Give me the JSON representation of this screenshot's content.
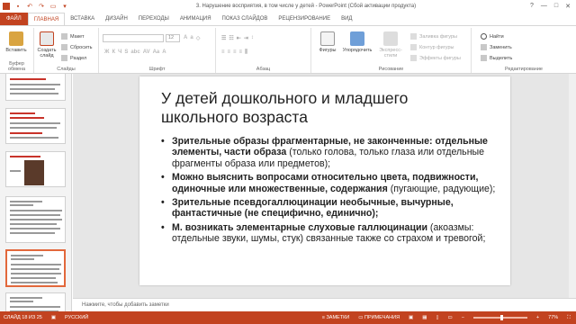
{
  "window": {
    "title": "3. Нарушение восприятия, в том числе у детей - PowerPoint (Сбой активации продукта)",
    "app_logo": "P",
    "controls": [
      "?",
      "—",
      "□",
      "✕"
    ]
  },
  "quick_access": {
    "icons": [
      "save-icon",
      "undo-icon",
      "redo-icon",
      "present-icon",
      "customize-icon"
    ]
  },
  "tabs": [
    "ФАЙЛ",
    "ГЛАВНАЯ",
    "ВСТАВКА",
    "ДИЗАЙН",
    "ПЕРЕХОДЫ",
    "АНИМАЦИЯ",
    "ПОКАЗ СЛАЙДОВ",
    "РЕЦЕНЗИРОВАНИЕ",
    "ВИД"
  ],
  "active_tab": "ГЛАВНАЯ",
  "ribbon": {
    "clipboard": {
      "paste": "Вставить",
      "label": "Буфер обмена"
    },
    "slides": {
      "create": "Создать слайд",
      "layout": "Макет",
      "reset": "Сбросить",
      "section": "Раздел",
      "label": "Слайды"
    },
    "font": {
      "name_placeholder": "",
      "size": "12",
      "label": "Шрифт"
    },
    "paragraph": {
      "label": "Абзац"
    },
    "drawing": {
      "shapes": "Фигуры",
      "arrange": "Упорядочить",
      "quick_styles": "Экспресс-стили",
      "fill": "Заливка фигуры",
      "outline": "Контур фигуры",
      "effects": "Эффекты фигуры",
      "label": "Рисование"
    },
    "editing": {
      "find": "Найти",
      "replace": "Заменить",
      "select": "Выделить",
      "label": "Редактирование"
    }
  },
  "thumbnails": [
    {
      "num": "",
      "selected": false
    },
    {
      "num": "",
      "selected": false
    },
    {
      "num": "",
      "selected": false
    },
    {
      "num": "",
      "selected": false
    },
    {
      "num": "",
      "selected": true
    },
    {
      "num": "",
      "selected": false
    }
  ],
  "slide": {
    "title": "У детей дошкольного и младшего школьного возраста",
    "bullets": [
      {
        "bold": "Зрительные образы фрагментарные, не законченные: отдельные элементы, части образа",
        "normal": " (только голова, только глаза или отдельные фрагменты образа или предметов);"
      },
      {
        "bold": "Можно выяснить вопросами относительно цвета, подвижности, одиночные или множественные, содержания",
        "normal": " (пугающие, радующие);"
      },
      {
        "bold": "Зрительные псевдогаллюцинации необычные, вычурные, фантастичные (не специфично, единично);",
        "normal": ""
      },
      {
        "bold": "М. возникать элементарные слуховые галлюцинации",
        "normal": " (акоазмы: отдельные звуки, шумы, стук) связанные также со страхом и тревогой;"
      }
    ]
  },
  "notes_placeholder": "Нажмите, чтобы добавить заметки",
  "status": {
    "slide_counter": "СЛАЙД 18 ИЗ 25",
    "language": "РУССКИЙ",
    "notes": "ЗАМЕТКИ",
    "comments": "ПРИМЕЧАНИЯ",
    "zoom": "77%"
  },
  "colors": {
    "accent": "#c24320",
    "selected_thumb": "#e2683c"
  }
}
